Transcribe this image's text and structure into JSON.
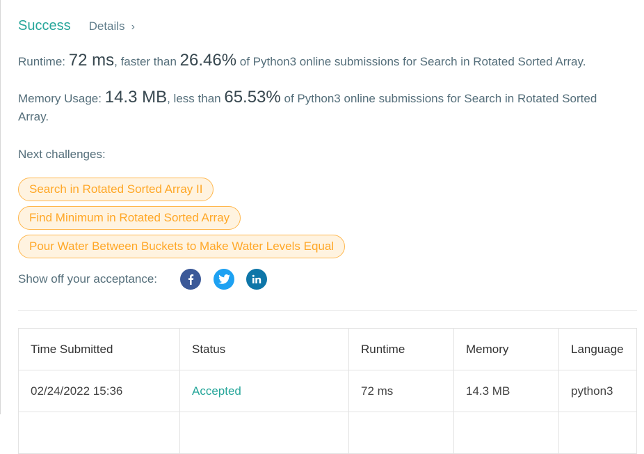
{
  "result": {
    "status": "Success",
    "details_label": "Details",
    "details_chevron": "›"
  },
  "runtime": {
    "label": "Runtime:",
    "value": "72 ms",
    "compare_text": ", faster than",
    "percent": "26.46%",
    "suffix": "of Python3 online submissions for Search in Rotated Sorted Array."
  },
  "memory": {
    "label": "Memory Usage:",
    "value": "14.3 MB",
    "compare_text": ", less than",
    "percent": "65.53%",
    "suffix": "of Python3 online submissions for Search in Rotated Sorted Array."
  },
  "next_challenges": {
    "title": "Next challenges:",
    "items": [
      "Search in Rotated Sorted Array II",
      "Find Minimum in Rotated Sorted Array",
      "Pour Water Between Buckets to Make Water Levels Equal"
    ]
  },
  "share": {
    "label": "Show off your acceptance:",
    "icons": [
      "facebook-icon",
      "twitter-icon",
      "linkedin-icon"
    ]
  },
  "table": {
    "headers": [
      "Time Submitted",
      "Status",
      "Runtime",
      "Memory",
      "Language"
    ],
    "rows": [
      {
        "time": "02/24/2022 15:36",
        "status": "Accepted",
        "runtime": "72 ms",
        "memory": "14.3 MB",
        "language": "python3"
      }
    ]
  },
  "colors": {
    "success": "#26a69a",
    "chip_text": "#ffa726",
    "chip_border": "#ffb74d",
    "chip_bg": "#fff3e0",
    "facebook": "#3b5998",
    "twitter": "#1da1f2",
    "linkedin": "#0e76a8"
  }
}
